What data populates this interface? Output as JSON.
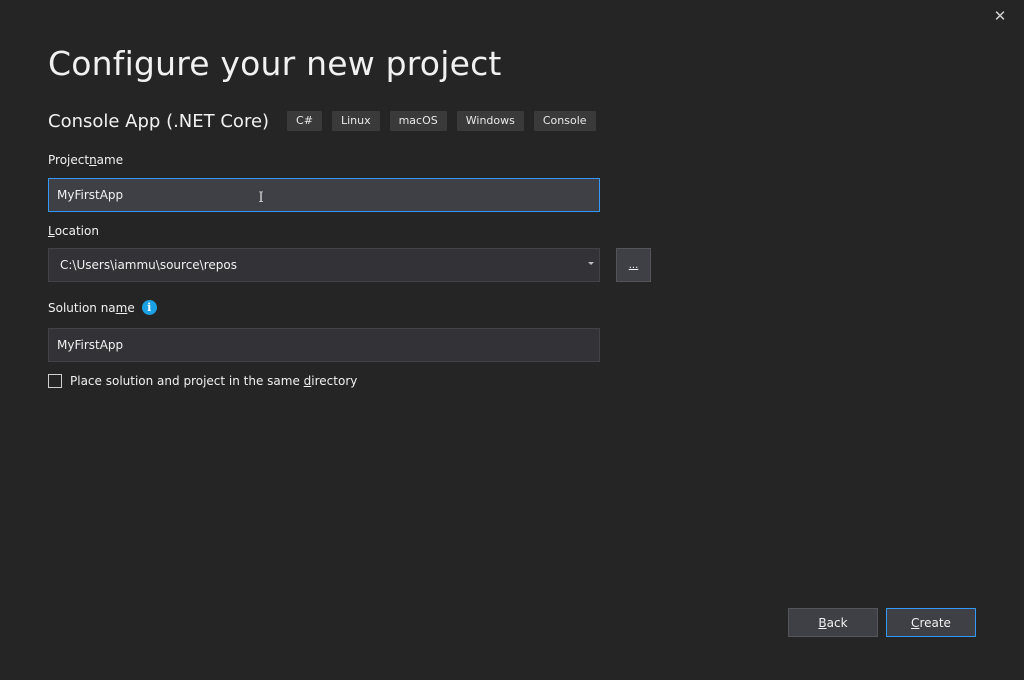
{
  "dialog": {
    "close_glyph": "✕",
    "title": "Configure your new project"
  },
  "template": {
    "name": "Console App (.NET Core)",
    "tags": [
      "C#",
      "Linux",
      "macOS",
      "Windows",
      "Console"
    ]
  },
  "project_name": {
    "label_pre": "Project ",
    "label_accel": "n",
    "label_post": "ame",
    "value": "MyFirstApp"
  },
  "location": {
    "label_accel": "L",
    "label_post": "ocation",
    "value": "C:\\Users\\iammu\\source\\repos",
    "browse_label": "..."
  },
  "solution_name": {
    "label_pre": "Solution na",
    "label_accel": "m",
    "label_post": "e",
    "info_glyph": "i",
    "value": "MyFirstApp"
  },
  "same_directory": {
    "label_pre": "Place solution and project in the same ",
    "label_accel": "d",
    "label_post": "irectory",
    "checked": false
  },
  "buttons": {
    "back_accel": "B",
    "back_post": "ack",
    "create_accel": "C",
    "create_post": "reate"
  },
  "colors": {
    "background": "#252526",
    "accent": "#3399ff",
    "info": "#1ba1e2"
  }
}
